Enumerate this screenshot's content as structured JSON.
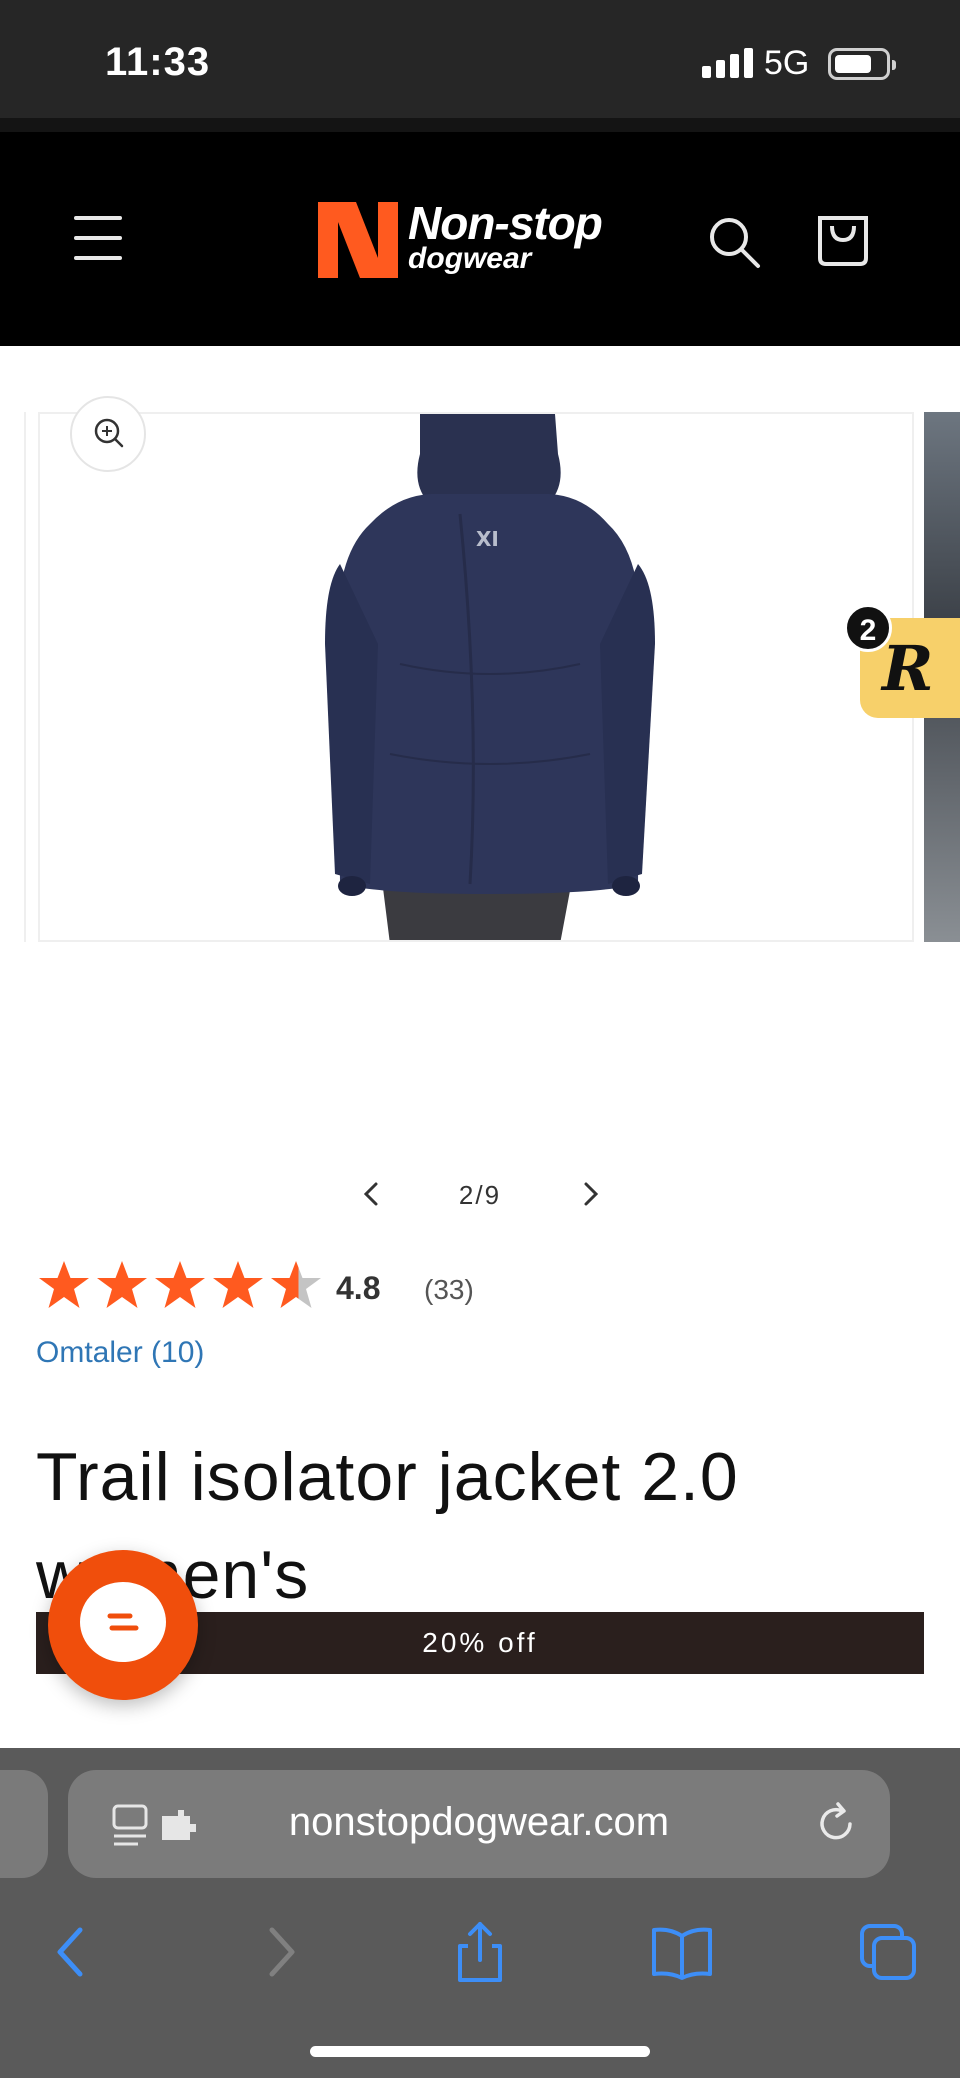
{
  "status_bar": {
    "time": "11:33",
    "network": "5G"
  },
  "header": {
    "logo_line1": "Non-stop",
    "logo_line2": "dogwear",
    "brand_color": "#ff5a1f"
  },
  "gallery": {
    "review_widget_count": "2",
    "review_widget_letter": "R",
    "counter": "2/9"
  },
  "product": {
    "rating_value": "4.8",
    "rating_count": "(33)",
    "rating": 4.8,
    "reviews_link": "Omtaler (10)",
    "title": "Trail isolator jacket 2.0 women's",
    "discount": "20% off"
  },
  "browser": {
    "url": "nonstopdogwear.com"
  },
  "colors": {
    "accent": "#ff5a1f",
    "link": "#2f76b5",
    "discount_bar": "#2a1f1d",
    "star": "#ff5a1f"
  }
}
